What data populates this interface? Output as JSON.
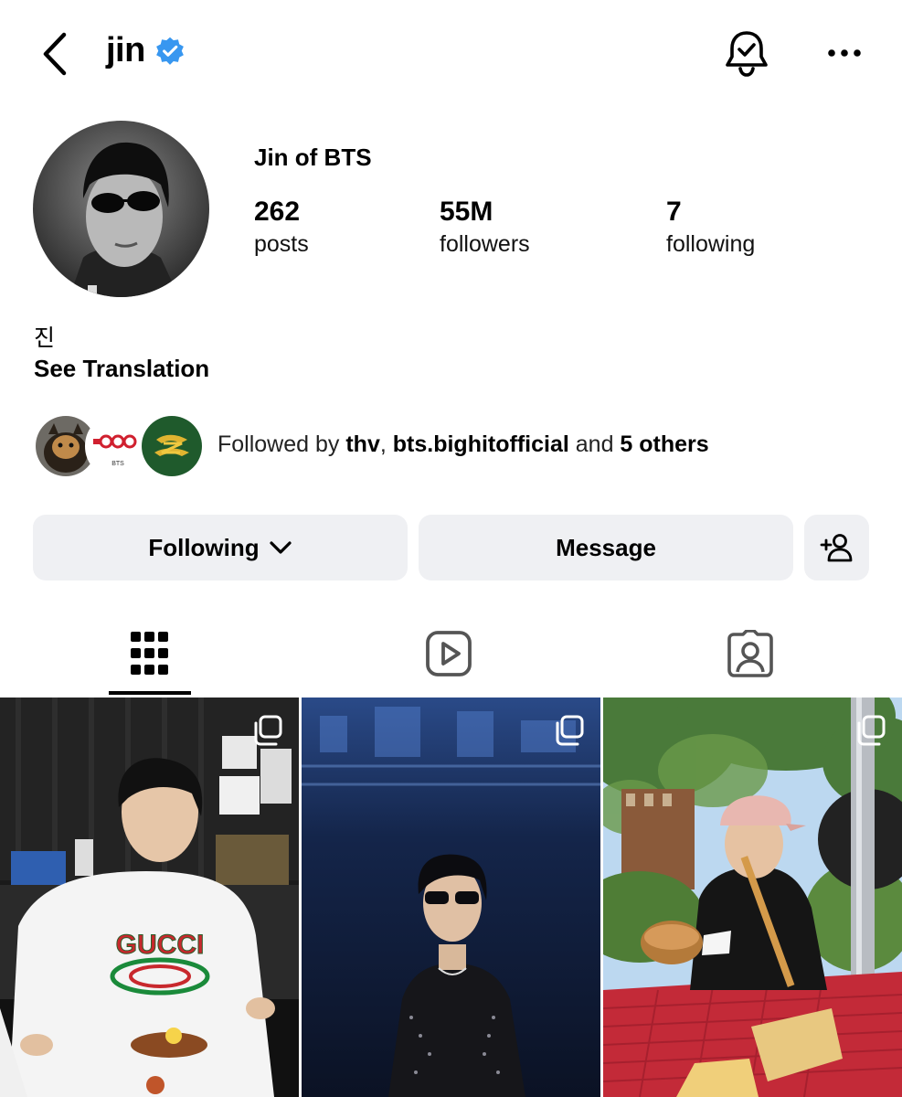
{
  "header": {
    "username": "jin",
    "verified": true,
    "icons": [
      "back-chevron-icon",
      "verified-badge-icon",
      "notification-bell-icon",
      "more-options-icon"
    ]
  },
  "profile": {
    "display_name": "Jin of BTS",
    "stats": {
      "posts": {
        "value": "262",
        "label": "posts"
      },
      "followers": {
        "value": "55M",
        "label": "followers"
      },
      "following": {
        "value": "7",
        "label": "following"
      }
    },
    "bio_name": "진",
    "see_translation": "See Translation"
  },
  "followed_by": {
    "prefix": "Followed by ",
    "user1": "thv",
    "separator": ", ",
    "user2": "bts.bighitofficial",
    "connector": " and ",
    "others": "5 others",
    "avatar_labels": [
      "BTS"
    ]
  },
  "actions": {
    "following_label": "Following",
    "message_label": "Message",
    "add_user_icon": "add-user-icon"
  },
  "tabs": [
    {
      "name": "posts-grid",
      "icon": "grid-icon",
      "active": true
    },
    {
      "name": "reels",
      "icon": "reels-icon",
      "active": false
    },
    {
      "name": "tagged",
      "icon": "tagged-person-icon",
      "active": false
    }
  ],
  "posts": [
    {
      "logo_text": "GUCCI",
      "multi": true
    },
    {
      "multi": true
    },
    {
      "multi": true
    }
  ],
  "colors": {
    "verified_blue": "#3897f0",
    "button_bg": "#eff0f3",
    "text": "#000000"
  }
}
